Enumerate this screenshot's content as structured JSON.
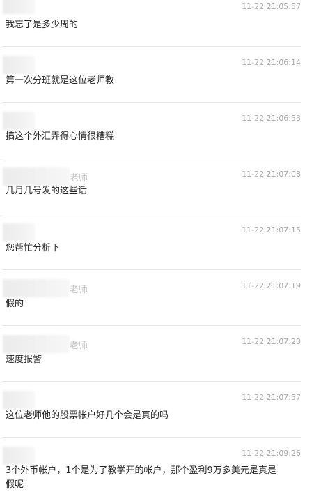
{
  "messages": [
    {
      "name": "",
      "time": "11-22 21:05:57",
      "text": "我忘了是多少周的"
    },
    {
      "name": "",
      "time": "11-22 21:06:14",
      "text": "第一次分班就是这位老师教"
    },
    {
      "name": "",
      "time": "11-22 21:06:53",
      "text": "搞这个外汇弄得心情很糟糕"
    },
    {
      "name": "老师",
      "time": "11-22 21:07:08",
      "text": "几月几号发的这些话"
    },
    {
      "name": "",
      "time": "11-22 21:07:15",
      "text": "您帮忙分析下"
    },
    {
      "name": "老师",
      "time": "11-22 21:07:19",
      "text": "假的"
    },
    {
      "name": "老师",
      "time": "11-22 21:07:20",
      "text": "速度报警"
    },
    {
      "name": "",
      "time": "11-22 21:07:57",
      "text": "这位老师他的股票帐户好几个会是真的吗"
    },
    {
      "name": "",
      "time": "11-22 21:09:26",
      "text": "3个外币帐户，1个是为了教学开的帐户，那个盈利9万多美元是真是假呢"
    }
  ]
}
